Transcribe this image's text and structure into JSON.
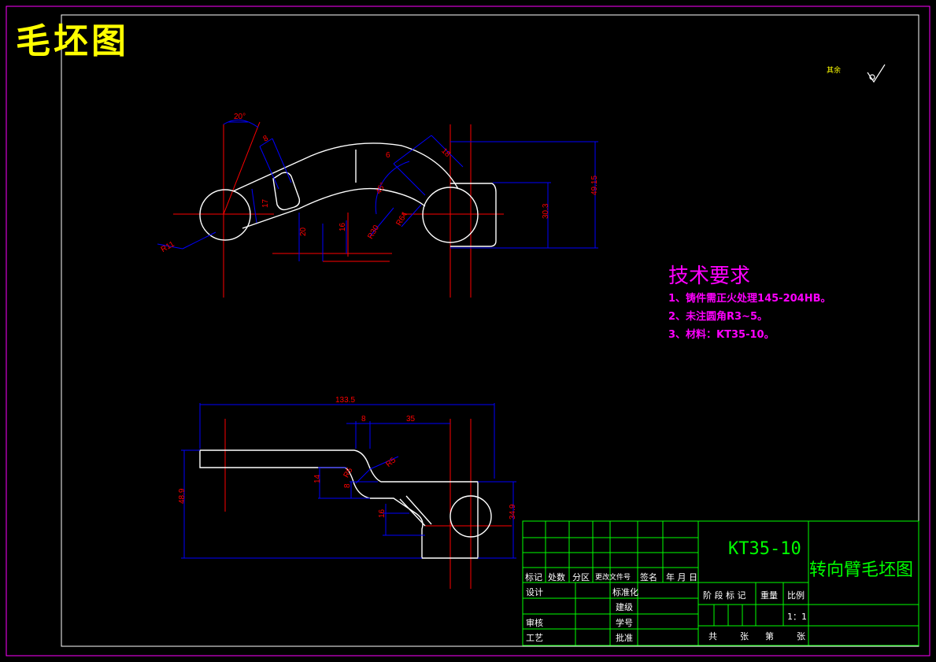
{
  "drawing": {
    "title": "毛坯图",
    "roughness_note": "其余"
  },
  "technical_requirements": {
    "heading": "技术要求",
    "items": [
      "1、铸件需正火处理145-204HB。",
      "2、未注圆角R3~5。",
      "3、材料：KT35-10。"
    ]
  },
  "top_view_dims": {
    "angle": "20°",
    "d8": "8",
    "d18": "18",
    "d6": "6",
    "d45": "45°",
    "d17": "17",
    "r30": "R30",
    "r64": "R64",
    "r11": "R11",
    "d20": "20",
    "d16": "16",
    "d30_3": "30.3",
    "d49_15": "49.15"
  },
  "front_view_dims": {
    "d133_5": "133.5",
    "d8": "8",
    "d35": "35",
    "r5a": "R5",
    "r5b": "R5",
    "d14": "14",
    "d8b": "8",
    "d16": "16",
    "d48_9": "48.9",
    "d34_9": "34.9"
  },
  "title_block": {
    "part_code": "KT35-10",
    "part_name": "转向臂毛坯图",
    "header_labels": [
      "标记",
      "处数",
      "分区",
      "更改文件号",
      "签名",
      "年 月 日"
    ],
    "left_labels": [
      "设计",
      "审核",
      "工艺"
    ],
    "mid_labels": [
      "标准化",
      "建级",
      "学号",
      "批准"
    ],
    "right_header": [
      "阶 段 标 记",
      "重量",
      "比例"
    ],
    "scale": "1：1",
    "sheet_info": [
      "共",
      "张",
      "第",
      "张"
    ]
  },
  "colors": {
    "background": "#000000",
    "frame": "#ff00ff",
    "outline": "#ffffff",
    "centerline": "#ff0000",
    "dimension": "#0000ff",
    "dim_text": "#ff0000",
    "title": "#ffff00",
    "title_block": "#00ff00"
  }
}
